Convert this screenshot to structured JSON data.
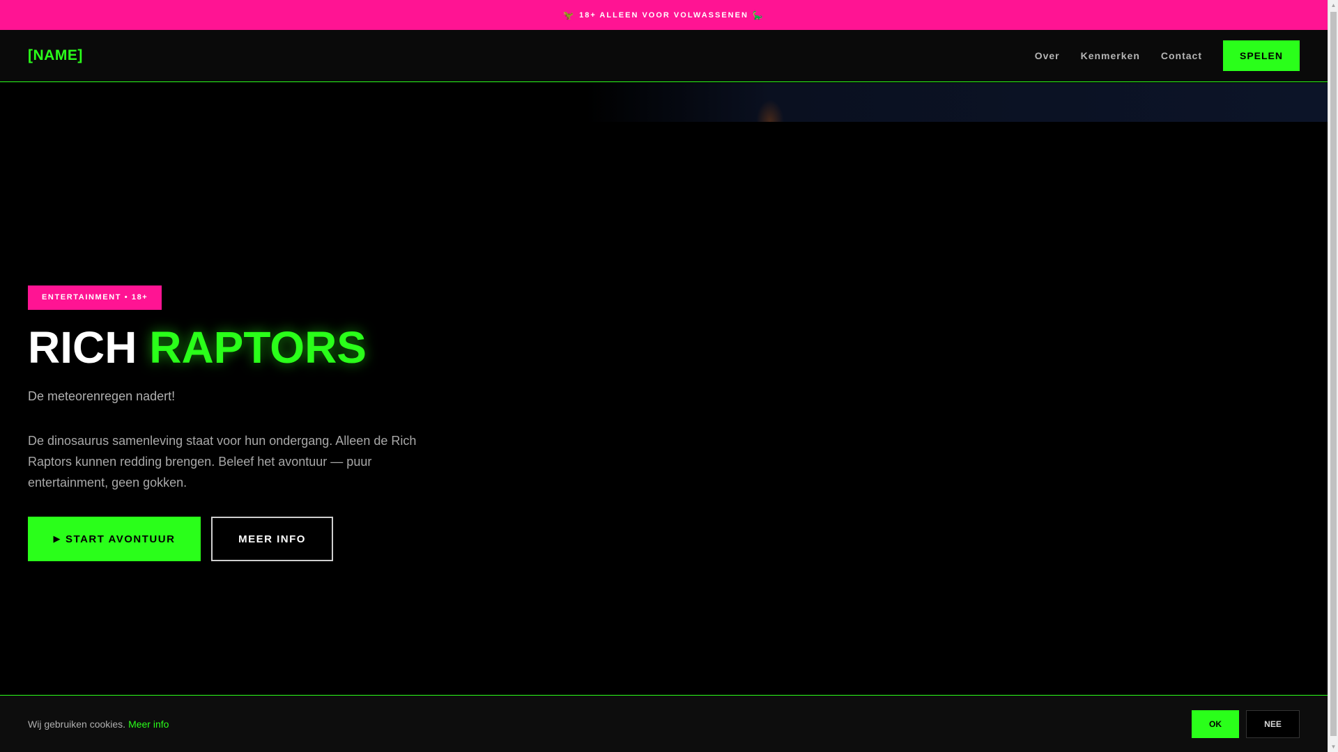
{
  "age_banner": {
    "icon_left": "🦖",
    "text": "18+ ALLEEN VOOR VOLWASSENEN",
    "icon_right": "🦕"
  },
  "nav": {
    "brand": "[NAME]",
    "links": [
      "Over",
      "Kenmerken",
      "Contact"
    ],
    "cta": "SPELEN"
  },
  "hero": {
    "tag": "ENTERTAINMENT • 18+",
    "title_main": "RICH",
    "title_accent": "RAPTORS",
    "subtitle": "De meteorenregen nadert!",
    "description": "De dinosaurus samenleving staat voor hun ondergang. Alleen de Rich Raptors kunnen redding brengen. Beleef het avontuur — puur entertainment, geen gokken.",
    "primary_icon": "▶",
    "primary_label": "START AVONTUUR",
    "secondary_label": "MEER INFO"
  },
  "cookie": {
    "text": "Wij gebruiken cookies.",
    "link": "Meer info",
    "ok": "OK",
    "no": "NEE"
  },
  "scrollbar": {
    "up_icon": "▲",
    "down_icon": "▼"
  },
  "colors": {
    "accent_green": "#2aff1a",
    "accent_pink": "#ff1493",
    "background": "#000000"
  }
}
